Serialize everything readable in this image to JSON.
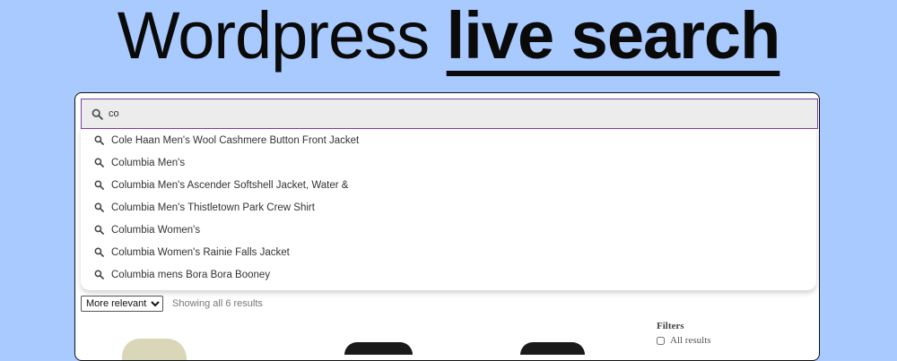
{
  "headline": {
    "light": "Wordpress",
    "bold": "live search"
  },
  "search": {
    "value": "co",
    "placeholder": "",
    "icon": "search-icon"
  },
  "suggestions": [
    {
      "label": "Cole Haan Men's Wool Cashmere Button Front Jacket"
    },
    {
      "label": "Columbia Men's"
    },
    {
      "label": "Columbia Men's Ascender Softshell Jacket, Water &"
    },
    {
      "label": "Columbia Men's Thistletown Park Crew Shirt"
    },
    {
      "label": "Columbia Women's"
    },
    {
      "label": "Columbia Women's Rainie Falls Jacket"
    },
    {
      "label": "Columbia mens Bora Bora Booney"
    }
  ],
  "toolbar": {
    "sort_selected": "More relevant",
    "result_count": "Showing all 6 results"
  },
  "filters": {
    "title": "Filters",
    "options": [
      {
        "label": "All results"
      }
    ]
  },
  "colors": {
    "background": "#a9caff",
    "search_border": "#7b3fa6",
    "search_fill": "#ececec"
  }
}
